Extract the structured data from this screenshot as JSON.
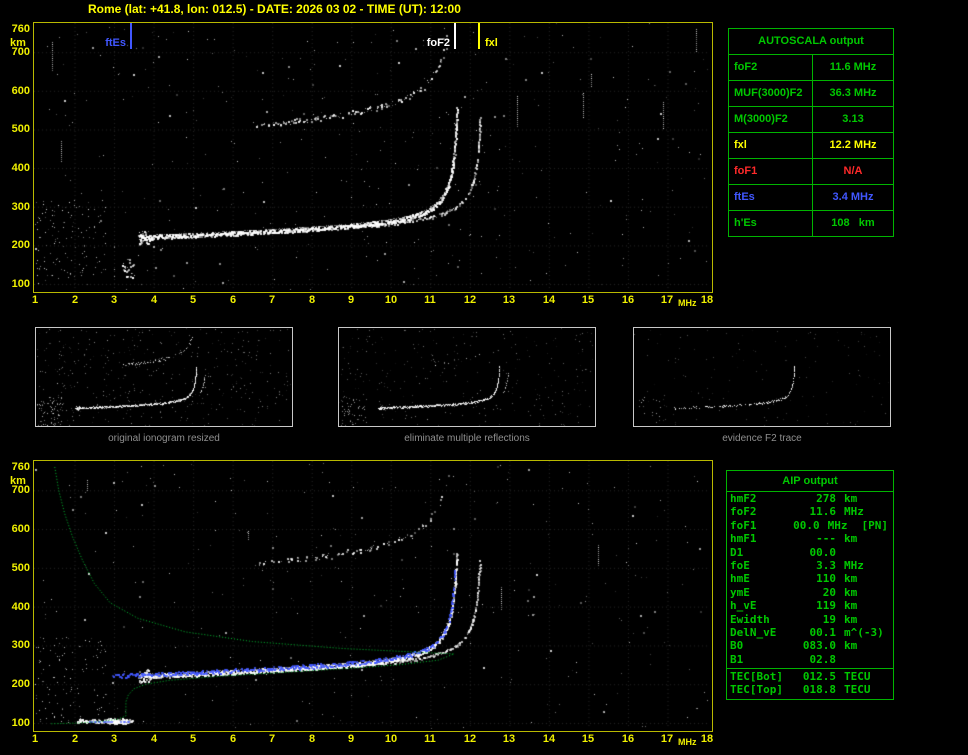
{
  "title": "Rome (lat: +41.8, lon: 012.5) - DATE: 2026 03 02 - TIME (UT): 12:00",
  "colors": {
    "axis_yellow": "#f0f000",
    "frame_yellow": "#b9b900",
    "table_green": "#00c800",
    "table_border_green": "#00b400",
    "marker_blue": "#4157ff",
    "status_red": "#ff2a2a",
    "marker_yellow": "#ffff00",
    "trace_white": "#ffffff",
    "profile_green": "#00c832",
    "caption_gray": "#8f8f8f"
  },
  "autoscala": {
    "title": "AUTOSCALA output",
    "rows": [
      {
        "label": "foF2",
        "value": "11.6 MHz",
        "color": "#00c800"
      },
      {
        "label": "MUF(3000)F2",
        "value": "36.3 MHz",
        "color": "#00c800"
      },
      {
        "label": "M(3000)F2",
        "value": "3.13",
        "color": "#00c800"
      },
      {
        "label": "fxl",
        "value": "12.2 MHz",
        "color": "#ffff00"
      },
      {
        "label": "foF1",
        "value": "N/A",
        "color": "#ff2a2a"
      },
      {
        "label": "ftEs",
        "value": "3.4 MHz",
        "color": "#4157ff"
      },
      {
        "label": "h'Es",
        "value": "108   km",
        "color": "#00c800"
      }
    ]
  },
  "aip": {
    "title": "AIP output",
    "rows": [
      {
        "name": "hmF2",
        "value": "278",
        "unit": "km",
        "extra": ""
      },
      {
        "name": "foF2",
        "value": "11.6",
        "unit": "MHz",
        "extra": ""
      },
      {
        "name": "foF1",
        "value": "00.0",
        "unit": "MHz",
        "extra": "[PN]"
      },
      {
        "name": "hmF1",
        "value": "---",
        "unit": "km",
        "extra": ""
      },
      {
        "name": "D1",
        "value": "00.0",
        "unit": "",
        "extra": ""
      },
      {
        "name": "foE",
        "value": "3.3",
        "unit": "MHz",
        "extra": ""
      },
      {
        "name": "hmE",
        "value": "110",
        "unit": "km",
        "extra": ""
      },
      {
        "name": "ymE",
        "value": "20",
        "unit": "km",
        "extra": ""
      },
      {
        "name": "h_vE",
        "value": "119",
        "unit": "km",
        "extra": ""
      },
      {
        "name": "Ewidth",
        "value": "19",
        "unit": "km",
        "extra": ""
      },
      {
        "name": "DelN_vE",
        "value": "00.1",
        "unit": "m^(-3)",
        "extra": ""
      },
      {
        "name": "B0",
        "value": "083.0",
        "unit": "km",
        "extra": ""
      },
      {
        "name": "B1",
        "value": "02.8",
        "unit": "",
        "extra": ""
      }
    ],
    "tec_rows": [
      {
        "name": "TEC[Bot]",
        "value": "012.5",
        "unit": "TECU",
        "extra": ""
      },
      {
        "name": "TEC[Top]",
        "value": "018.8",
        "unit": "TECU",
        "extra": ""
      }
    ]
  },
  "thumbnails": [
    {
      "caption": "original ionogram resized"
    },
    {
      "caption": "eliminate multiple reflections"
    },
    {
      "caption": "evidence F2 trace"
    }
  ],
  "chart_data": [
    {
      "type": "scatter",
      "title": "vertical-incidence ionogram (top panel)",
      "xlabel": "MHz",
      "ylabel": "km",
      "xlim": [
        1,
        18
      ],
      "ylim": [
        100,
        760
      ],
      "xticks": [
        1,
        2,
        3,
        4,
        5,
        6,
        7,
        8,
        9,
        10,
        11,
        12,
        13,
        14,
        15,
        16,
        17,
        18
      ],
      "yticks": [
        760,
        700,
        600,
        500,
        400,
        300,
        200,
        100
      ],
      "grid": true,
      "foF2": 11.6,
      "fxI": 12.2,
      "markers": [
        {
          "label": "ftEs",
          "freq_mhz": 3.4,
          "color": "#4157ff"
        },
        {
          "label": "foF2",
          "freq_mhz": 11.6,
          "color": "#ffffff"
        },
        {
          "label": "fxl",
          "freq_mhz": 12.2,
          "color": "#ffff00"
        }
      ],
      "o_trace_virtual_height_km": [
        [
          3.7,
          222
        ],
        [
          4.5,
          226
        ],
        [
          5.5,
          232
        ],
        [
          6.5,
          238
        ],
        [
          7.5,
          245
        ],
        [
          8.5,
          253
        ],
        [
          9.5,
          262
        ],
        [
          10.5,
          278
        ],
        [
          11.0,
          295
        ],
        [
          11.3,
          324
        ],
        [
          11.45,
          355
        ],
        [
          11.55,
          420
        ],
        [
          11.6,
          520
        ]
      ],
      "x_trace_virtual_height_km": [
        [
          11.6,
          300
        ],
        [
          12.0,
          345
        ],
        [
          12.15,
          420
        ],
        [
          12.2,
          520
        ]
      ],
      "second_hop_km": [
        [
          6.8,
          530
        ],
        [
          8.0,
          560
        ],
        [
          9.0,
          585
        ],
        [
          10.0,
          615
        ],
        [
          11.0,
          655
        ],
        [
          11.3,
          690
        ]
      ]
    },
    {
      "type": "scatter",
      "title": "ionogram with AIP electron-density profile (bottom panel)",
      "xlabel": "MHz",
      "ylabel": "km",
      "xlim": [
        1,
        18
      ],
      "ylim": [
        100,
        760
      ],
      "xticks": [
        1,
        2,
        3,
        4,
        5,
        6,
        7,
        8,
        9,
        10,
        11,
        12,
        13,
        14,
        15,
        16,
        17,
        18
      ],
      "yticks": [
        760,
        700,
        600,
        500,
        400,
        300,
        200,
        100
      ],
      "grid": true,
      "foF2": 11.6,
      "fxI": 12.2,
      "foE": 3.3,
      "hmF2": 278,
      "hmE": 110,
      "scaled_trace_color": "#4157ff",
      "profile_f_h": [
        [
          1.5,
          760
        ],
        [
          1.6,
          700
        ],
        [
          1.75,
          640
        ],
        [
          1.95,
          580
        ],
        [
          2.2,
          520
        ],
        [
          2.5,
          460
        ],
        [
          2.9,
          410
        ],
        [
          3.6,
          370
        ],
        [
          4.8,
          335
        ],
        [
          6.5,
          310
        ],
        [
          8.8,
          292
        ],
        [
          10.6,
          283
        ],
        [
          11.6,
          278
        ],
        [
          11.2,
          262
        ],
        [
          10.2,
          250
        ],
        [
          8.8,
          240
        ],
        [
          7.2,
          230
        ],
        [
          5.6,
          220
        ],
        [
          4.4,
          210
        ],
        [
          3.8,
          200
        ],
        [
          3.5,
          188
        ],
        [
          3.36,
          172
        ],
        [
          3.3,
          155
        ],
        [
          3.3,
          135
        ],
        [
          3.3,
          118
        ],
        [
          3.1,
          110
        ],
        [
          2.7,
          104
        ],
        [
          2.1,
          100
        ],
        [
          1.4,
          98
        ]
      ]
    }
  ]
}
